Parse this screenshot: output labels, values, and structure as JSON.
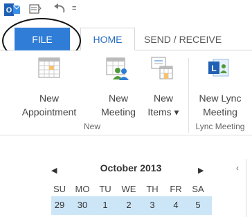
{
  "qat": {
    "customize_glyph": "≡"
  },
  "tabs": {
    "file": "FILE",
    "home": "HOME",
    "send_receive": "SEND / RECEIVE"
  },
  "ribbon": {
    "buttons": {
      "new_appointment": [
        "New",
        "Appointment"
      ],
      "new_meeting": [
        "New",
        "Meeting"
      ],
      "new_items": [
        "New",
        "Items ▾"
      ],
      "new_lync_meeting": [
        "New Lync",
        "Meeting"
      ]
    },
    "groups": {
      "new": "New",
      "lync": "Lync Meeting"
    }
  },
  "calendar": {
    "month_title": "October 2013",
    "prev_glyph": "◀",
    "next_glyph": "▶",
    "collapse_glyph": "‹",
    "weekday_headers": [
      "SU",
      "MO",
      "TU",
      "WE",
      "TH",
      "FR",
      "SA"
    ],
    "first_week": [
      "29",
      "30",
      "1",
      "2",
      "3",
      "4",
      "5"
    ]
  },
  "colors": {
    "file_tab": "#2f7dd6",
    "accent": "#2b6fc2",
    "week_highlight": "#cde6f7"
  }
}
